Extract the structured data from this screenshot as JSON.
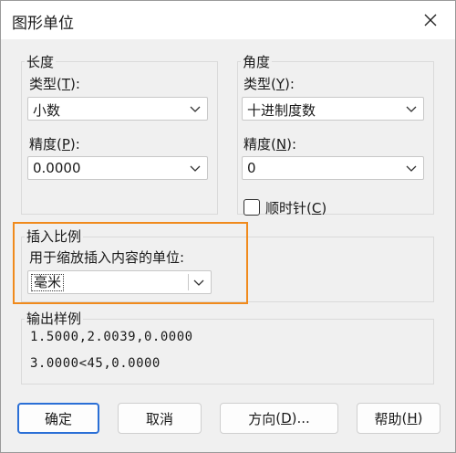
{
  "dialog": {
    "title": "图形单位"
  },
  "length": {
    "group_label": "长度",
    "type_label": "类型",
    "type_key": "T",
    "type_value": "小数",
    "precision_label": "精度",
    "precision_key": "P",
    "precision_value": "0.0000"
  },
  "angle": {
    "group_label": "角度",
    "type_label": "类型",
    "type_key": "Y",
    "type_value": "十进制度数",
    "precision_label": "精度",
    "precision_key": "N",
    "precision_value": "0",
    "clockwise_label": "顺时针",
    "clockwise_key": "C",
    "clockwise_checked": false
  },
  "insertion": {
    "group_label": "插入比例",
    "units_label": "用于缩放插入内容的单位:",
    "units_value": "毫米"
  },
  "output": {
    "group_label": "输出样例",
    "line1": "1.5000,2.0039,0.0000",
    "line2": "3.0000<45,0.0000"
  },
  "buttons": {
    "ok": "确定",
    "cancel": "取消",
    "direction": "方向",
    "direction_key": "D",
    "help": "帮助",
    "help_key": "H"
  },
  "colors": {
    "highlight": "#f08a1c",
    "default_button_border": "#2a6fd6"
  }
}
